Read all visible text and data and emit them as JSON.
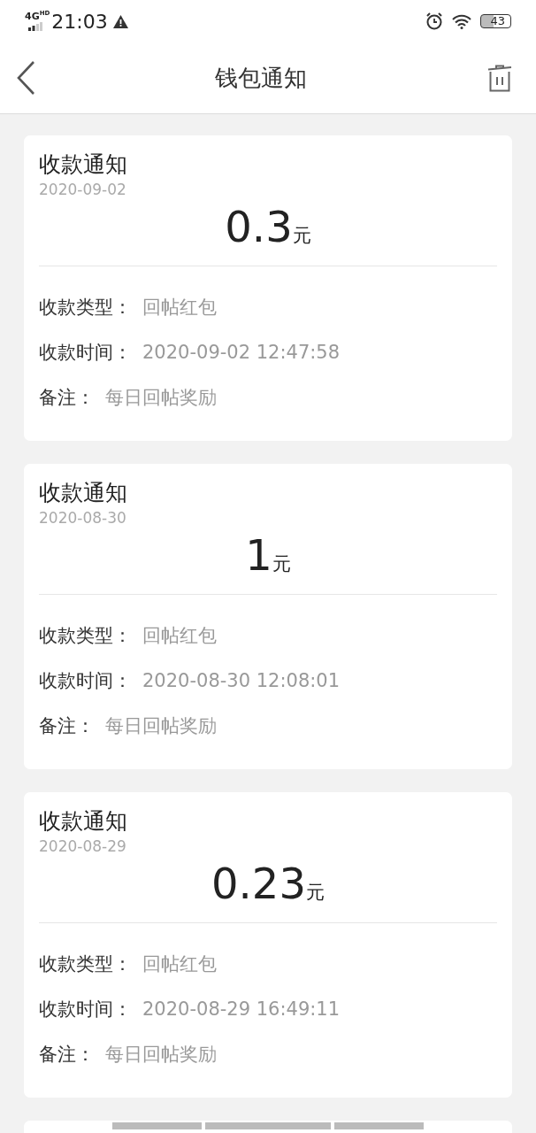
{
  "status_bar": {
    "network": "4G",
    "network_sup": "HD",
    "time": "21:03",
    "battery": "43"
  },
  "header": {
    "title": "钱包通知"
  },
  "notifications": [
    {
      "title": "收款通知",
      "date": "2020-09-02",
      "amount": "0.3",
      "unit": "元",
      "fields": [
        {
          "label": "收款类型：",
          "value": "回帖红包"
        },
        {
          "label": "收款时间：",
          "value": "2020-09-02 12:47:58"
        },
        {
          "label": "备注：",
          "value": "每日回帖奖励"
        }
      ]
    },
    {
      "title": "收款通知",
      "date": "2020-08-30",
      "amount": "1",
      "unit": "元",
      "fields": [
        {
          "label": "收款类型：",
          "value": "回帖红包"
        },
        {
          "label": "收款时间：",
          "value": "2020-08-30 12:08:01"
        },
        {
          "label": "备注：",
          "value": "每日回帖奖励"
        }
      ]
    },
    {
      "title": "收款通知",
      "date": "2020-08-29",
      "amount": "0.23",
      "unit": "元",
      "fields": [
        {
          "label": "收款类型：",
          "value": "回帖红包"
        },
        {
          "label": "收款时间：",
          "value": "2020-08-29 16:49:11"
        },
        {
          "label": "备注：",
          "value": "每日回帖奖励"
        }
      ]
    }
  ]
}
